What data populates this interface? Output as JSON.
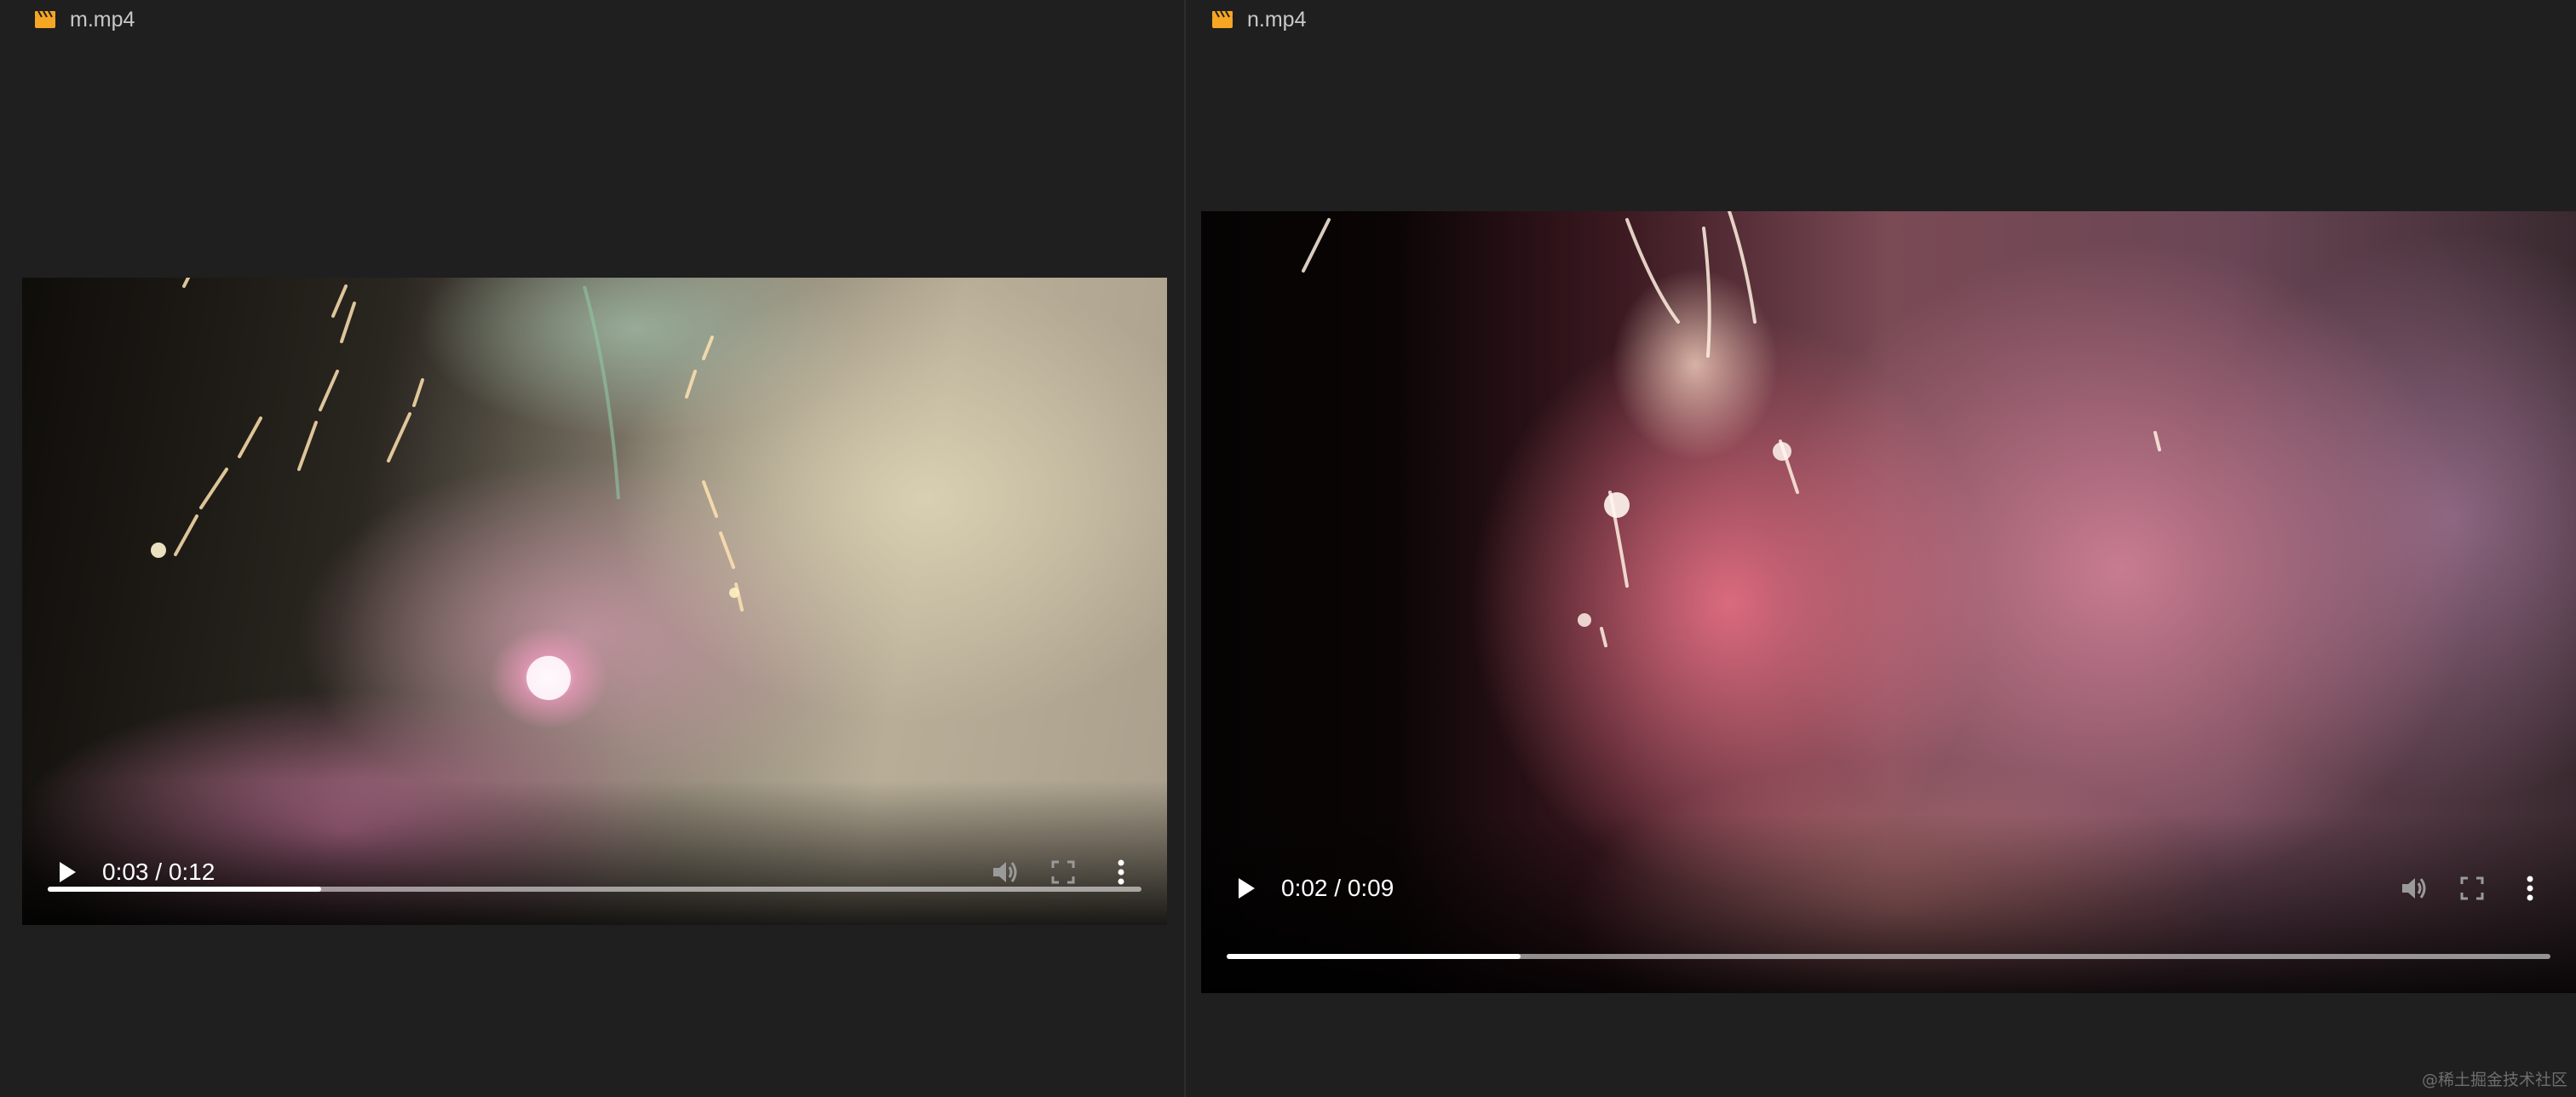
{
  "panes": [
    {
      "tab": {
        "icon": "clapperboard-icon",
        "filename": "m.mp4"
      },
      "video": {
        "time_display": "0:03 / 0:12",
        "progress": 0.25
      }
    },
    {
      "tab": {
        "icon": "clapperboard-icon",
        "filename": "n.mp4"
      },
      "video": {
        "time_display": "0:02 / 0:09",
        "progress": 0.2222
      }
    }
  ],
  "icons": {
    "play": "play-icon",
    "mute": "volume-icon",
    "fullscreen": "fullscreen-icon",
    "more": "more-options-icon"
  },
  "colors": {
    "background": "#1f1f1f",
    "file_icon": "#f5a623",
    "tab_text": "#c8c8c8",
    "progress_track": "#8a8a8a",
    "progress_fill": "#ffffff"
  },
  "watermark": "@稀土掘金技术社区"
}
